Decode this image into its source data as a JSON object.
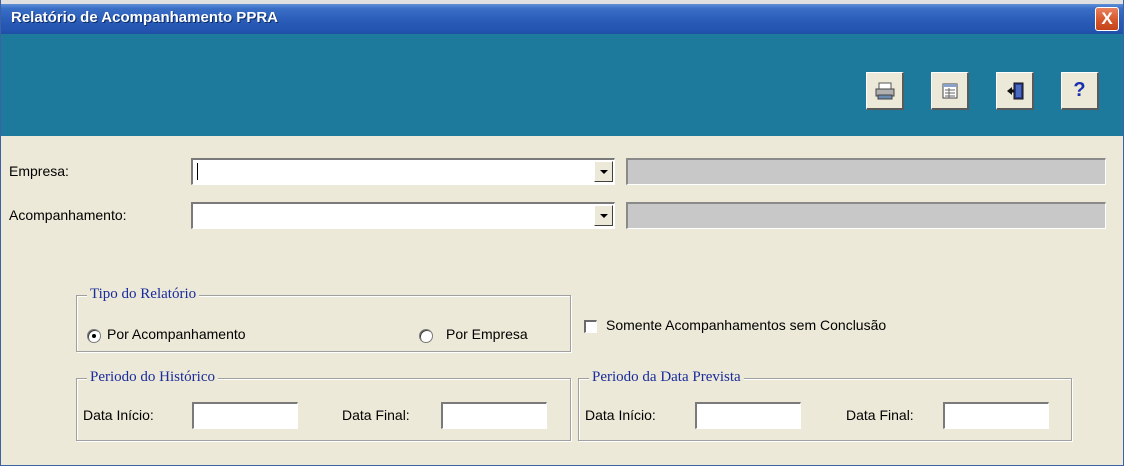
{
  "window": {
    "title": "Relatório de Acompanhamento PPRA",
    "close_symbol": "X"
  },
  "toolbar": {
    "buttons": [
      {
        "name": "print",
        "icon": "printer-icon"
      },
      {
        "name": "preview",
        "icon": "report-preview-icon"
      },
      {
        "name": "exit",
        "icon": "exit-door-icon"
      },
      {
        "name": "help",
        "icon": "help-icon",
        "glyph": "?"
      }
    ],
    "background_color": "#1d7a9c"
  },
  "form": {
    "empresa": {
      "label": "Empresa:",
      "value": "",
      "description": ""
    },
    "acompanhamento": {
      "label": "Acompanhamento:",
      "value": "",
      "description": ""
    },
    "tipo_relatorio": {
      "title": "Tipo do Relatório",
      "options": [
        {
          "label": "Por Acompanhamento",
          "selected": true
        },
        {
          "label": "Por Empresa",
          "selected": false
        }
      ]
    },
    "somente_sem_conclusao": {
      "label": "Somente Acompanhamentos sem Conclusão",
      "checked": false
    },
    "periodo_historico": {
      "title": "Periodo do Histórico",
      "data_inicio_label": "Data Início:",
      "data_inicio_value": "",
      "data_final_label": "Data Final:",
      "data_final_value": ""
    },
    "periodo_data_prevista": {
      "title": "Periodo da Data Prevista",
      "data_inicio_label": "Data Início:",
      "data_inicio_value": "",
      "data_final_label": "Data Final:",
      "data_final_value": ""
    }
  },
  "colors": {
    "titlebar": "#2a5cb8",
    "group_title": "#1a2b9c",
    "panel": "#ece9d8"
  }
}
